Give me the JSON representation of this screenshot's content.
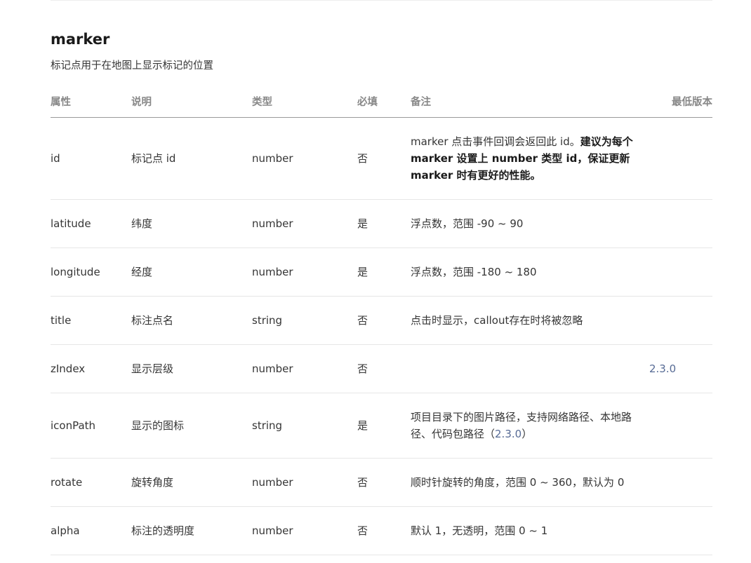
{
  "section": {
    "title": "marker",
    "description": "标记点用于在地图上显示标记的位置"
  },
  "table": {
    "headers": [
      "属性",
      "说明",
      "类型",
      "必填",
      "备注",
      "最低版本"
    ],
    "rows": [
      {
        "attr": "id",
        "desc": "标记点 id",
        "type": "number",
        "required": "否",
        "note_plain": "marker 点击事件回调会返回此 id。",
        "note_bold": "建议为每个 marker 设置上 number 类型 id，保证更新 marker 时有更好的性能。",
        "version": ""
      },
      {
        "attr": "latitude",
        "desc": "纬度",
        "type": "number",
        "required": "是",
        "note": "浮点数，范围 -90 ~ 90",
        "version": ""
      },
      {
        "attr": "longitude",
        "desc": "经度",
        "type": "number",
        "required": "是",
        "note": "浮点数，范围 -180 ~ 180",
        "version": ""
      },
      {
        "attr": "title",
        "desc": "标注点名",
        "type": "string",
        "required": "否",
        "note": "点击时显示，callout存在时将被忽略",
        "version": ""
      },
      {
        "attr": "zIndex",
        "desc": "显示层级",
        "type": "number",
        "required": "否",
        "note": "",
        "version": "2.3.0"
      },
      {
        "attr": "iconPath",
        "desc": "显示的图标",
        "type": "string",
        "required": "是",
        "note": "项目目录下的图片路径，支持网络路径、本地路径、代码包路径（",
        "note_link": "2.3.0",
        "note_tail": "）",
        "version": ""
      },
      {
        "attr": "rotate",
        "desc": "旋转角度",
        "type": "number",
        "required": "否",
        "note": "顺时针旋转的角度，范围 0 ~ 360，默认为 0",
        "version": ""
      },
      {
        "attr": "alpha",
        "desc": "标注的透明度",
        "type": "number",
        "required": "否",
        "note": "默认 1，无透明，范围 0 ~ 1",
        "version": ""
      }
    ]
  },
  "colors": {
    "text": "#353535",
    "header": "#888888",
    "link": "#576b95",
    "divider": "#e6e6e6"
  }
}
